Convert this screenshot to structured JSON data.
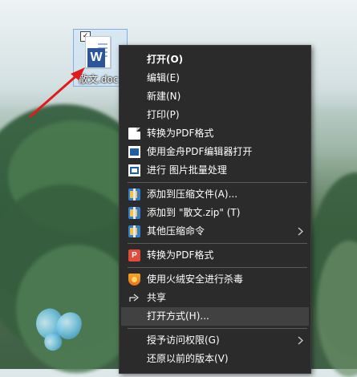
{
  "desktop": {
    "file_label": "散文.doc",
    "checkbox_mark": "✓",
    "word_badge": "W"
  },
  "context_menu": {
    "items": [
      {
        "label": "打开(O)",
        "icon": null,
        "bold": true
      },
      {
        "label": "编辑(E)",
        "icon": null
      },
      {
        "label": "新建(N)",
        "icon": null
      },
      {
        "label": "打印(P)",
        "icon": null
      },
      {
        "label": "转换为PDF格式",
        "icon": "document-icon"
      },
      {
        "label": "使用金舟PDF编辑器打开",
        "icon": "pdf-editor-icon"
      },
      {
        "label": "进行 图片批量处理",
        "icon": "image-batch-icon"
      },
      {
        "label": "添加到压缩文件(A)...",
        "icon": "archive-icon"
      },
      {
        "label": "添加到 \"散文.zip\" (T)",
        "icon": "archive-icon"
      },
      {
        "label": "其他压缩命令",
        "icon": "archive-icon",
        "submenu": true
      },
      {
        "label": "转换为PDF格式",
        "icon": "pdf-convert-icon",
        "icon_text": "P"
      },
      {
        "label": "使用火绒安全进行杀毒",
        "icon": "shield-icon"
      },
      {
        "label": "共享",
        "icon": "share-icon"
      },
      {
        "label": "打开方式(H)...",
        "icon": null,
        "highlighted": true
      },
      {
        "label": "授予访问权限(G)",
        "icon": null,
        "submenu": true
      },
      {
        "label": "还原以前的版本(V)",
        "icon": null
      }
    ]
  },
  "colors": {
    "menu_bg": "#2b2b2b",
    "menu_highlight": "#414141",
    "arrow": "#e01b1b"
  }
}
